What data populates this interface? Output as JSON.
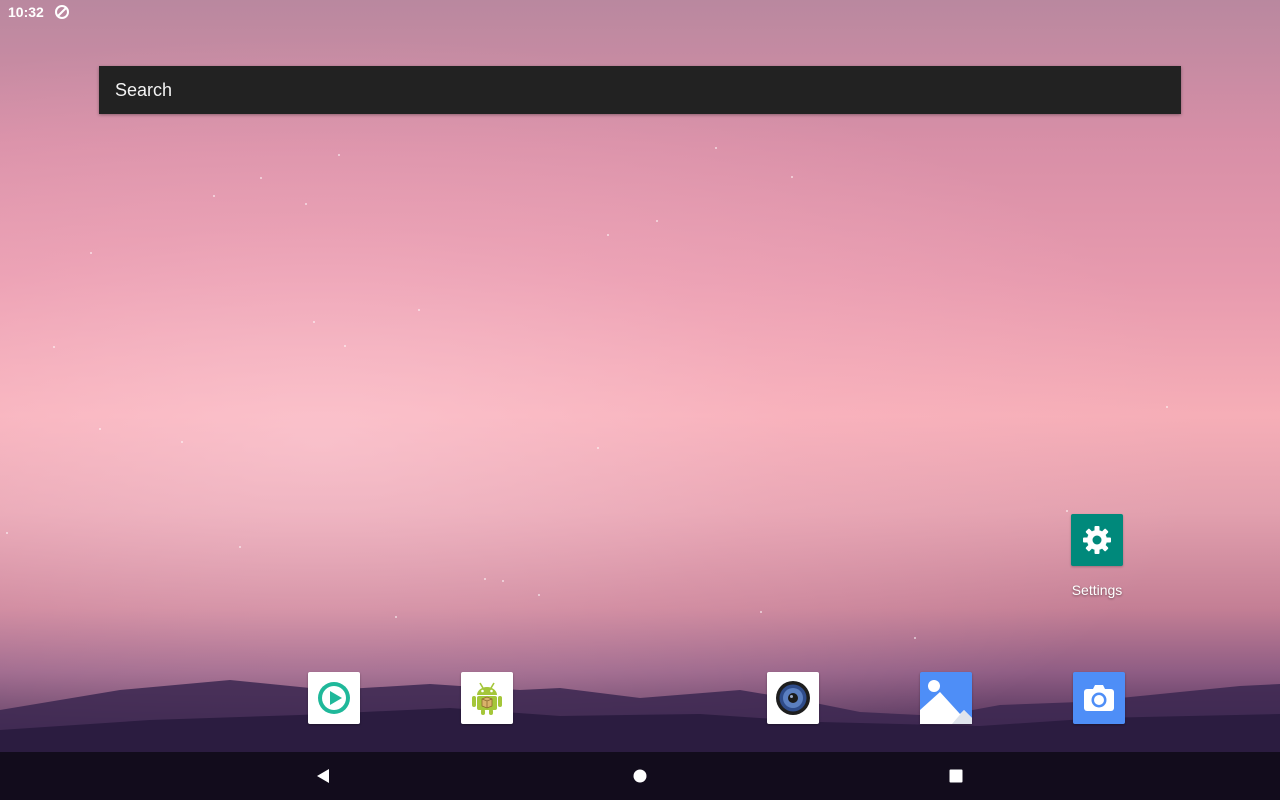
{
  "status_bar": {
    "time": "10:32",
    "icons": [
      "sync-icon"
    ]
  },
  "search": {
    "label": "Search"
  },
  "desktop_apps": [
    {
      "label": "Settings",
      "icon": "settings-gear-icon",
      "color": "#00897b"
    }
  ],
  "dock": [
    {
      "icon": "play-store-icon",
      "color": "#1fb89a"
    },
    {
      "icon": "android-package-icon",
      "color": "#a4c639"
    },
    {
      "icon": "speaker-icon",
      "color": "#2f4c8a"
    },
    {
      "icon": "gallery-icon",
      "color": "#4e8ef7"
    },
    {
      "icon": "camera-icon",
      "color": "#4e8ef7"
    }
  ],
  "nav_bar": {
    "buttons": [
      "back-icon",
      "home-icon",
      "recents-icon"
    ]
  },
  "colors": {
    "search_bg": "#222222",
    "nav_bg": "#120c1c",
    "settings_teal": "#00897b"
  }
}
